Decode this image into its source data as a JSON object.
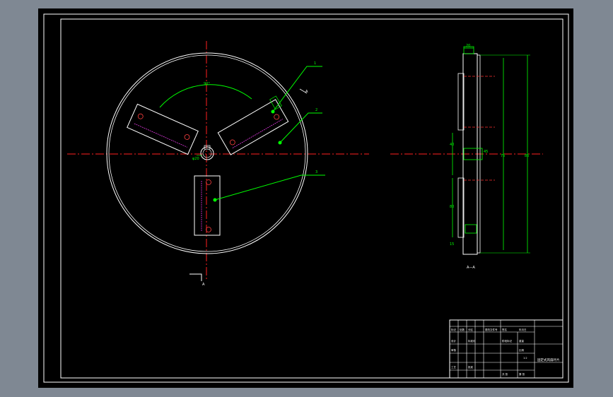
{
  "colors": {
    "workspace_bg": "#7f8893",
    "sheet": "#000000",
    "frame": "#ffffff",
    "centerline": "#ff2020",
    "leader": "#00ff00",
    "dimension": "#00ff00",
    "hidden": "#ff3030",
    "magenta": "#ff40ff",
    "accent_yellow": "#ffff00"
  },
  "views": {
    "front": {
      "section_mark": "A",
      "section_arrow_mark": "A",
      "angle_dim": "90°",
      "leaders": [
        {
          "label": "1"
        },
        {
          "label": "2"
        },
        {
          "label": "3"
        }
      ],
      "hole_dim": "φ20"
    },
    "side": {
      "view_label": "A—A",
      "top_dim": "20",
      "dims": [
        "85",
        "75",
        "80",
        "40",
        "45",
        "15"
      ]
    }
  },
  "title_block": {
    "drawing_title": "固定式风扇叶片",
    "rows": [
      {
        "a": "标记",
        "b": "处数",
        "c": "分区",
        "d": "更改文件号",
        "e": "签名",
        "f": "年月日"
      },
      {
        "a": "设计",
        "b": "",
        "c": "标准化",
        "d": "",
        "e": "阶段标记",
        "f": "重量"
      },
      {
        "a": "审核",
        "b": "",
        "c": "",
        "d": "",
        "e": "",
        "f": "比例"
      },
      {
        "a": "工艺",
        "b": "",
        "c": "批准",
        "d": "",
        "e": "共 张",
        "f": "第 张"
      }
    ],
    "scale": "1:2"
  }
}
